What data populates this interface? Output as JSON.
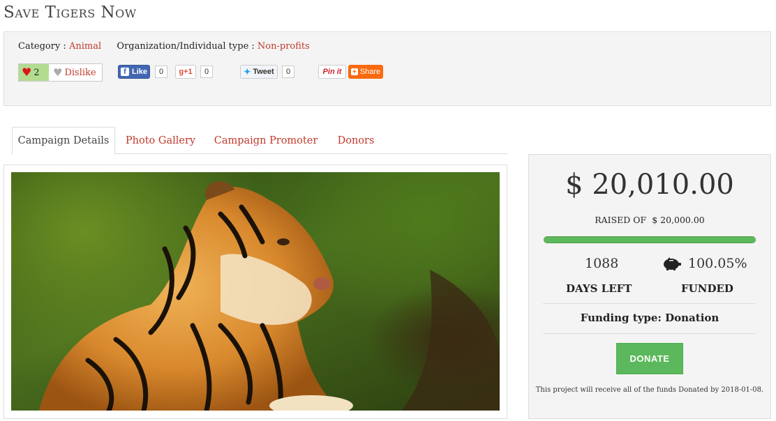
{
  "page": {
    "title": "Save Tigers Now"
  },
  "meta": {
    "category_label": "Category :",
    "category_value": "Animal",
    "org_label": "Organization/Individual type :",
    "org_value": "Non-profits"
  },
  "social": {
    "like_count": "2",
    "dislike_label": "Dislike",
    "fb_label": "Like",
    "fb_count": "0",
    "gplus_label": "+1",
    "gplus_count": "0",
    "tweet_label": "Tweet",
    "tweet_count": "0",
    "pin_label": "Pin it",
    "share_label": "Share"
  },
  "tabs": [
    {
      "label": "Campaign Details",
      "active": true
    },
    {
      "label": "Photo Gallery",
      "active": false
    },
    {
      "label": "Campaign Promoter",
      "active": false
    },
    {
      "label": "Donors",
      "active": false
    }
  ],
  "campaign": {
    "raised_amount": "$ 20,010.00",
    "raised_of_label": "RAISED OF",
    "goal_amount": "$ 20,000.00",
    "progress_fraction": 1.0,
    "days_left_value": "1088",
    "days_left_label": "DAYS LEFT",
    "funded_value": "100.05%",
    "funded_label": "FUNDED",
    "funding_type": "Funding type: Donation",
    "donate_label": "DONATE",
    "footnote": "This project will receive all of the funds Donated by 2018-01-08."
  },
  "colors": {
    "accent": "#c0392b",
    "success": "#5cb85c"
  }
}
